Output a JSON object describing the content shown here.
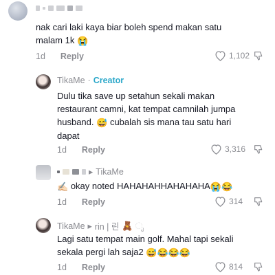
{
  "comments": [
    {
      "username": "",
      "text_line1": "nak cari laki kaya biar boleh spend makan satu",
      "text_line2": "malam 1k",
      "emoji": "😭",
      "age": "1d",
      "reply_label": "Reply",
      "likes": "1,102"
    },
    {
      "username": "TikaMe",
      "badge": "Creator",
      "text_line1": "Dulu tika save up setahun sekali makan",
      "text_line2": "restaurant camni, kat tempat camnilah jumpa",
      "text_line3": "husband.",
      "emoji": "😅",
      "text_line3b": "cubalah sis mana tau satu hari",
      "text_line4": "dapat",
      "age": "1d",
      "reply_label": "Reply",
      "likes": "3,316"
    },
    {
      "username": "",
      "reply_to": "TikaMe",
      "text": "okay noted HAHAHAHHAHAHAHA",
      "emoji_lead": "✍🏻",
      "emojis": "😭😂",
      "age": "1d",
      "reply_label": "Reply",
      "likes": "314"
    },
    {
      "username": "TikaMe",
      "reply_to": "rin | 린",
      "reply_to_deco": "🧸 ೃ",
      "text_line1": "Lagi satu tempat main golf. Mahal tapi sekali",
      "text_line2": "sekala pergi lah saja2",
      "emojis": "😅😂😂😂",
      "age": "1d",
      "reply_label": "Reply",
      "likes": "814"
    }
  ],
  "colors": {
    "text": "#161823",
    "muted": "#8a8b91",
    "creator": "#2aa7c9"
  }
}
